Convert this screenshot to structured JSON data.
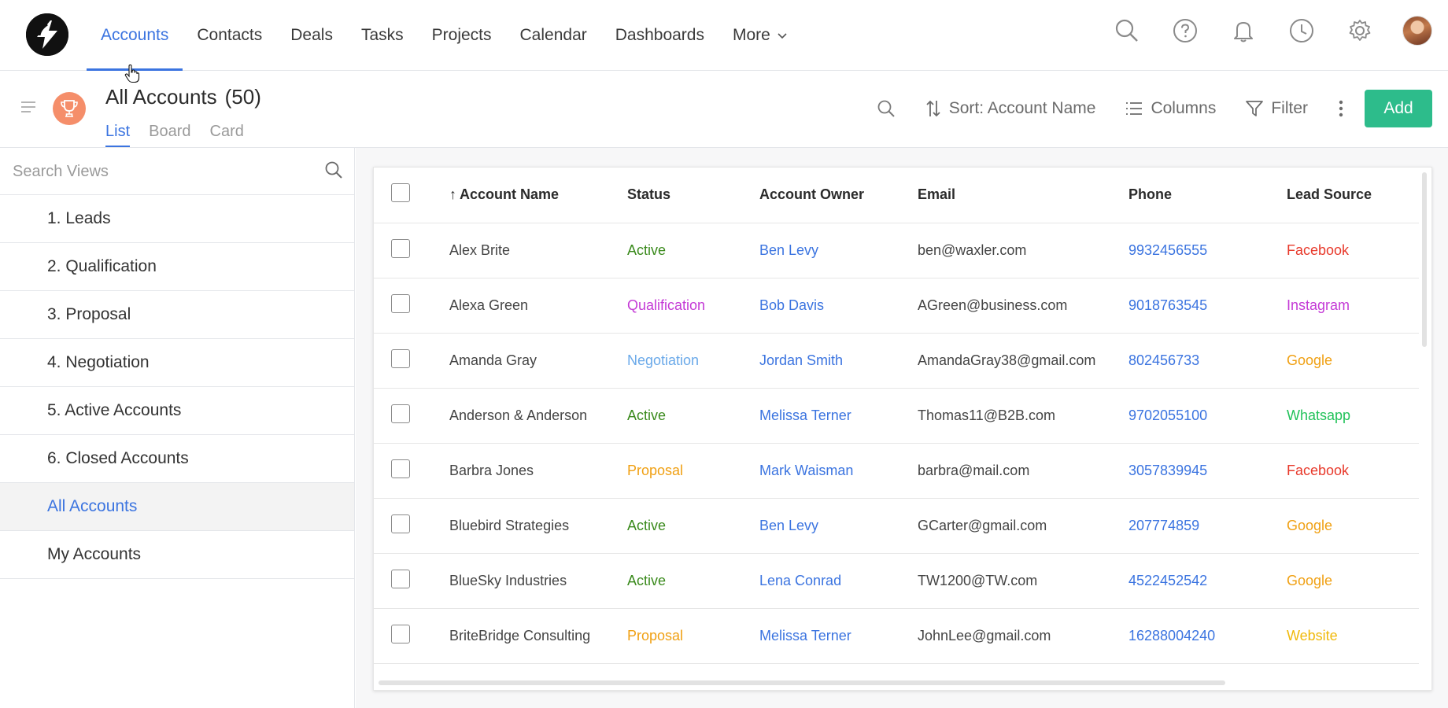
{
  "nav": {
    "items": [
      {
        "label": "Accounts",
        "active": true
      },
      {
        "label": "Contacts"
      },
      {
        "label": "Deals"
      },
      {
        "label": "Tasks"
      },
      {
        "label": "Projects"
      },
      {
        "label": "Calendar"
      },
      {
        "label": "Dashboards"
      },
      {
        "label": "More"
      }
    ],
    "icons": [
      "search-icon",
      "help-icon",
      "bell-icon",
      "history-icon",
      "gear-icon",
      "avatar"
    ]
  },
  "header": {
    "title": "All Accounts",
    "count": "(50)",
    "view_tabs": [
      {
        "label": "List",
        "active": true
      },
      {
        "label": "Board"
      },
      {
        "label": "Card"
      }
    ],
    "sort_label": "Sort: Account Name",
    "columns_label": "Columns",
    "filter_label": "Filter",
    "add_label": "Add"
  },
  "sidebar": {
    "search_placeholder": "Search Views",
    "items": [
      {
        "label": "1. Leads"
      },
      {
        "label": "2. Qualification"
      },
      {
        "label": "3. Proposal"
      },
      {
        "label": "4. Negotiation"
      },
      {
        "label": "5. Active Accounts"
      },
      {
        "label": "6. Closed Accounts"
      },
      {
        "label": "All Accounts",
        "active": true
      },
      {
        "label": "My Accounts"
      }
    ]
  },
  "table": {
    "columns": [
      "Account Name",
      "Status",
      "Account Owner",
      "Email",
      "Phone",
      "Lead Source"
    ],
    "sort_indicator": "↑",
    "rows": [
      {
        "name": "Alex Brite",
        "status": "Active",
        "owner": "Ben Levy",
        "email": "ben@waxler.com",
        "phone": "9932456555",
        "source": "Facebook"
      },
      {
        "name": "Alexa Green",
        "status": "Qualification",
        "owner": "Bob Davis",
        "email": "AGreen@business.com",
        "phone": "9018763545",
        "source": "Instagram"
      },
      {
        "name": "Amanda Gray",
        "status": "Negotiation",
        "owner": "Jordan Smith",
        "email": "AmandaGray38@gmail.com",
        "phone": "802456733",
        "source": "Google"
      },
      {
        "name": "Anderson & Anderson",
        "status": "Active",
        "owner": "Melissa Terner",
        "email": "Thomas11@B2B.com",
        "phone": "9702055100",
        "source": "Whatsapp"
      },
      {
        "name": "Barbra Jones",
        "status": "Proposal",
        "owner": "Mark Waisman",
        "email": "barbra@mail.com",
        "phone": "3057839945",
        "source": "Facebook"
      },
      {
        "name": "Bluebird Strategies",
        "status": "Active",
        "owner": "Ben Levy",
        "email": "GCarter@gmail.com",
        "phone": "207774859",
        "source": "Google"
      },
      {
        "name": "BlueSky Industries",
        "status": "Active",
        "owner": "Lena Conrad",
        "email": "TW1200@TW.com",
        "phone": "4522452542",
        "source": "Google"
      },
      {
        "name": "BriteBridge Consulting",
        "status": "Proposal",
        "owner": "Melissa Terner",
        "email": "JohnLee@gmail.com",
        "phone": "16288004240",
        "source": "Website"
      }
    ]
  },
  "colors": {
    "accent": "#3b74e0",
    "add_button": "#2dbc8b",
    "status_active": "#3a8a1c",
    "status_qualification": "#c43ad6",
    "status_negotiation": "#6aa9e9",
    "status_proposal": "#f0a013",
    "source_facebook": "#e8392b",
    "source_instagram": "#c43ad6",
    "source_google": "#f0a013",
    "source_whatsapp": "#22c25a",
    "source_website": "#f0b90b"
  }
}
